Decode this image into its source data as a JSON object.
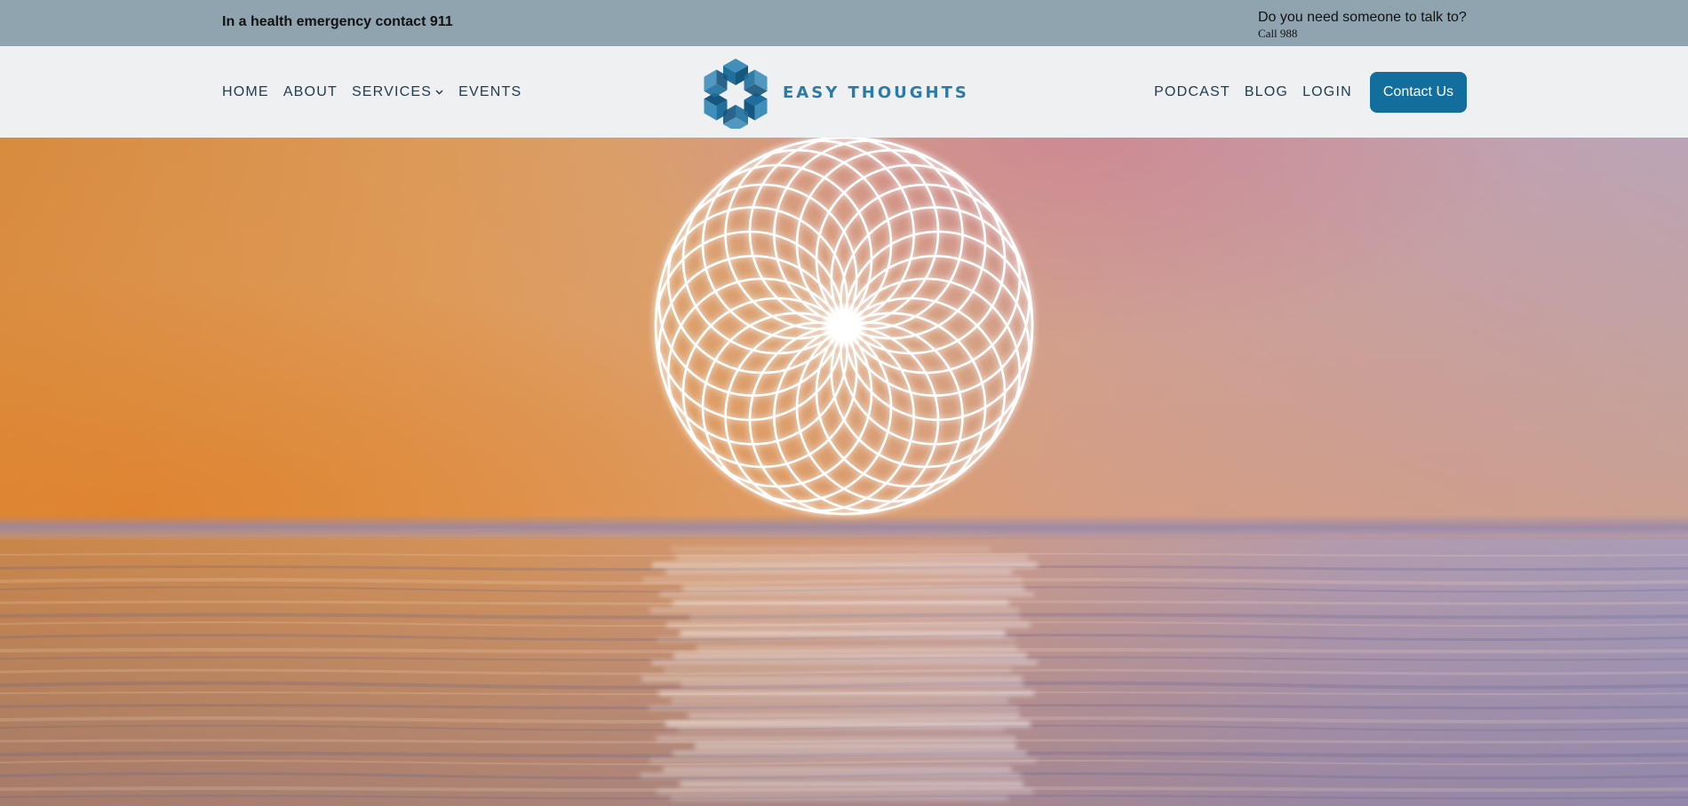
{
  "topbar": {
    "emergency_text": "In a health emergency contact 911",
    "talk_text": "Do you need someone to talk to?",
    "call_text": "Call 988"
  },
  "nav": {
    "left_items": [
      {
        "label": "HOME"
      },
      {
        "label": "ABOUT"
      },
      {
        "label": "SERVICES",
        "icon": "chevron-down-icon"
      },
      {
        "label": "EVENTS"
      }
    ],
    "logo_text": "EASY THOUGHTS",
    "right_items": [
      {
        "label": "PODCAST"
      },
      {
        "label": "BLOG"
      },
      {
        "label": "LOGIN"
      }
    ],
    "contact_label": "Contact Us"
  },
  "colors": {
    "topbar_bg": "#90a4af",
    "navbar_bg": "#eef0f1",
    "accent": "#126e9c",
    "logo_blue": "#2b7ba6"
  },
  "hero": {
    "image": "sunset over sea with glowing white geometric flower pattern"
  }
}
